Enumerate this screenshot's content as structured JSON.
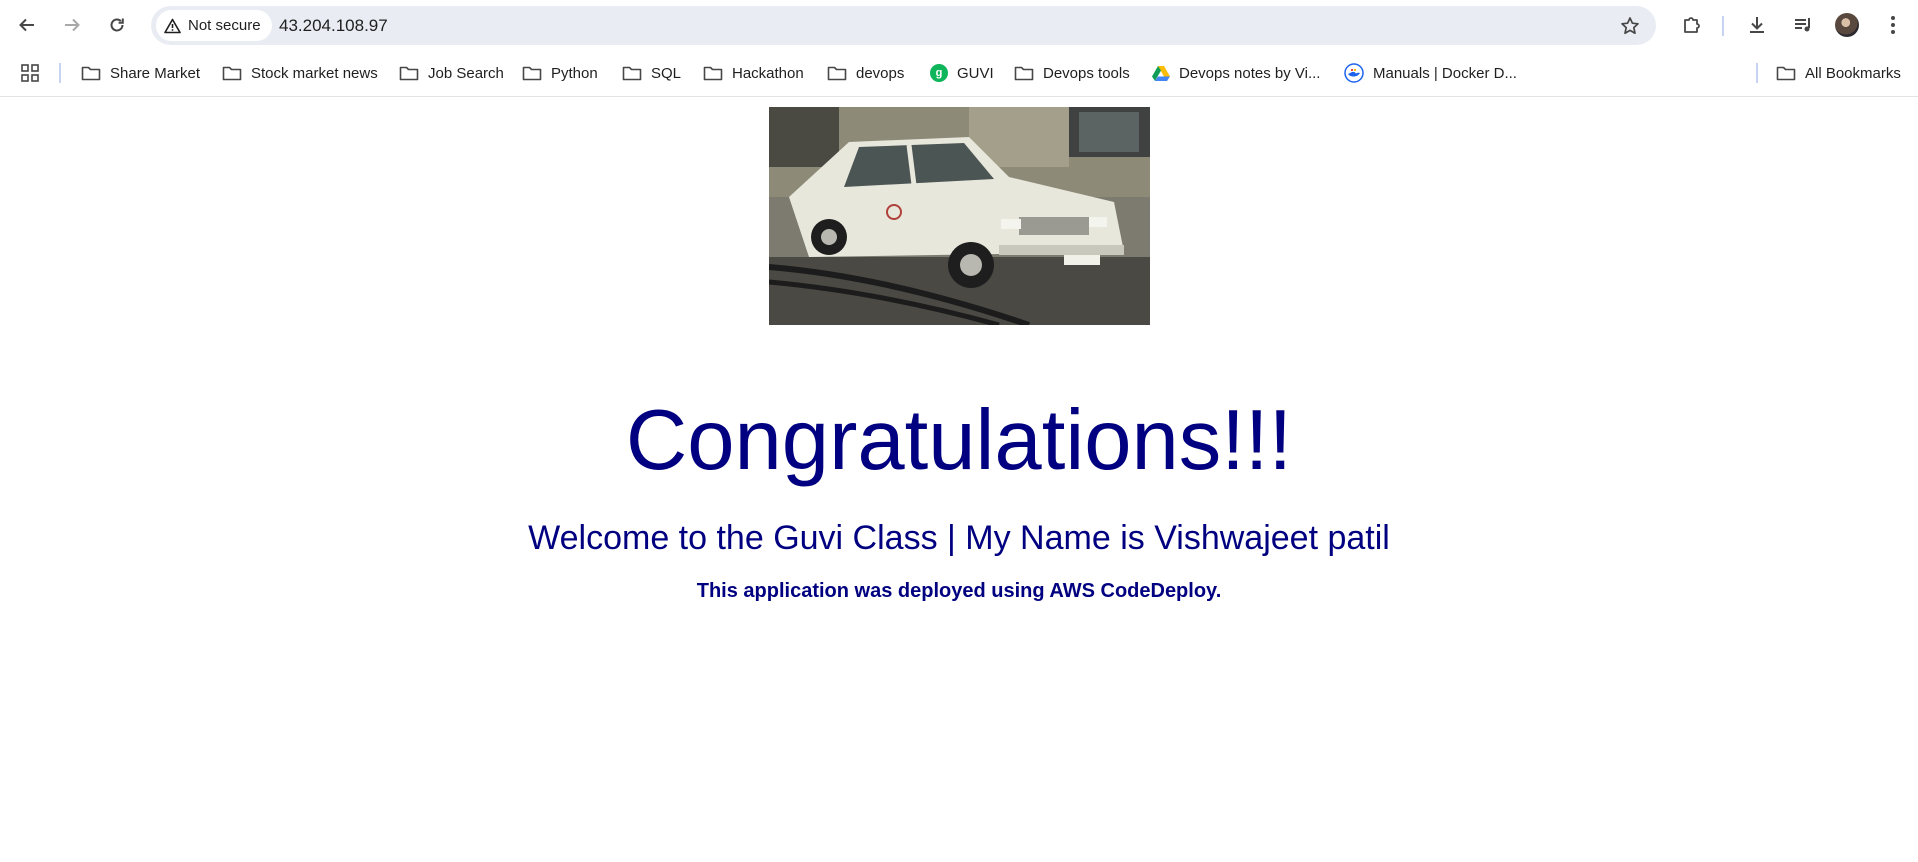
{
  "browser": {
    "security_label": "Not secure",
    "url": "43.204.108.97"
  },
  "bookmarks": {
    "items": [
      {
        "label": "Share Market",
        "icon": "folder-icon"
      },
      {
        "label": "Stock market news",
        "icon": "folder-icon"
      },
      {
        "label": "Job Search",
        "icon": "folder-icon"
      },
      {
        "label": "Python",
        "icon": "folder-icon"
      },
      {
        "label": "SQL",
        "icon": "folder-icon"
      },
      {
        "label": "Hackathon",
        "icon": "folder-icon"
      },
      {
        "label": "devops",
        "icon": "folder-icon"
      },
      {
        "label": "GUVI",
        "icon": "guvi-icon"
      },
      {
        "label": "Devops tools",
        "icon": "folder-icon"
      },
      {
        "label": "Devops notes by Vi...",
        "icon": "google-drive-icon"
      },
      {
        "label": "Manuals | Docker D...",
        "icon": "docker-icon"
      }
    ],
    "all_bookmarks": "All Bookmarks"
  },
  "page": {
    "headline": "Congratulations!!!",
    "welcome": "Welcome to the Guvi Class | My Name is Vishwajeet patil",
    "deploy_note": "This application was deployed using AWS CodeDeploy."
  },
  "colors": {
    "text": "#000080",
    "omnibox": "#e9edf3"
  }
}
